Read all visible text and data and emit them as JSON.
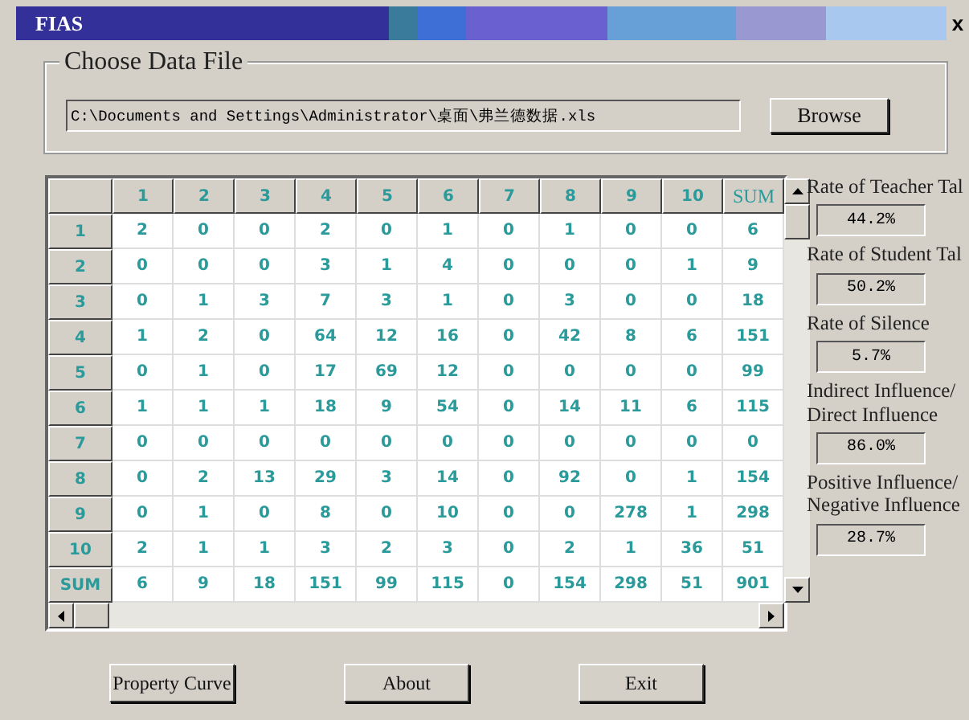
{
  "window": {
    "title": "FIAS",
    "close": "x"
  },
  "file_group": {
    "title": "Choose Data File",
    "path": "C:\\Documents and Settings\\Administrator\\桌面\\弗兰德数据.xls",
    "browse": "Browse"
  },
  "table": {
    "columns": [
      "1",
      "2",
      "3",
      "4",
      "5",
      "6",
      "7",
      "8",
      "9",
      "10",
      "SUM"
    ],
    "rows": [
      {
        "label": "1",
        "cells": [
          "2",
          "0",
          "0",
          "2",
          "0",
          "1",
          "0",
          "1",
          "0",
          "0",
          "6"
        ]
      },
      {
        "label": "2",
        "cells": [
          "0",
          "0",
          "0",
          "3",
          "1",
          "4",
          "0",
          "0",
          "0",
          "1",
          "9"
        ]
      },
      {
        "label": "3",
        "cells": [
          "0",
          "1",
          "3",
          "7",
          "3",
          "1",
          "0",
          "3",
          "0",
          "0",
          "18"
        ]
      },
      {
        "label": "4",
        "cells": [
          "1",
          "2",
          "0",
          "64",
          "12",
          "16",
          "0",
          "42",
          "8",
          "6",
          "151"
        ]
      },
      {
        "label": "5",
        "cells": [
          "0",
          "1",
          "0",
          "17",
          "69",
          "12",
          "0",
          "0",
          "0",
          "0",
          "99"
        ]
      },
      {
        "label": "6",
        "cells": [
          "1",
          "1",
          "1",
          "18",
          "9",
          "54",
          "0",
          "14",
          "11",
          "6",
          "115"
        ]
      },
      {
        "label": "7",
        "cells": [
          "0",
          "0",
          "0",
          "0",
          "0",
          "0",
          "0",
          "0",
          "0",
          "0",
          "0"
        ]
      },
      {
        "label": "8",
        "cells": [
          "0",
          "2",
          "13",
          "29",
          "3",
          "14",
          "0",
          "92",
          "0",
          "1",
          "154"
        ]
      },
      {
        "label": "9",
        "cells": [
          "0",
          "1",
          "0",
          "8",
          "0",
          "10",
          "0",
          "0",
          "278",
          "1",
          "298"
        ]
      },
      {
        "label": "10",
        "cells": [
          "2",
          "1",
          "1",
          "3",
          "2",
          "3",
          "0",
          "2",
          "1",
          "36",
          "51"
        ]
      },
      {
        "label": "SUM",
        "cells": [
          "6",
          "9",
          "18",
          "151",
          "99",
          "115",
          "0",
          "154",
          "298",
          "51",
          "901"
        ]
      }
    ]
  },
  "stats": [
    {
      "label": "Rate of Teacher Tal",
      "value": "44.2%"
    },
    {
      "label": "Rate of Student Tal",
      "value": "50.2%"
    },
    {
      "label": "Rate of Silence",
      "value": "5.7%"
    },
    {
      "label": "Indirect Influence/ Direct Influence",
      "value": "86.0%"
    },
    {
      "label": "Positive Influence/ Negative Influence",
      "value": "28.7%"
    }
  ],
  "buttons": [
    "Property Curve",
    "About",
    "Exit"
  ]
}
